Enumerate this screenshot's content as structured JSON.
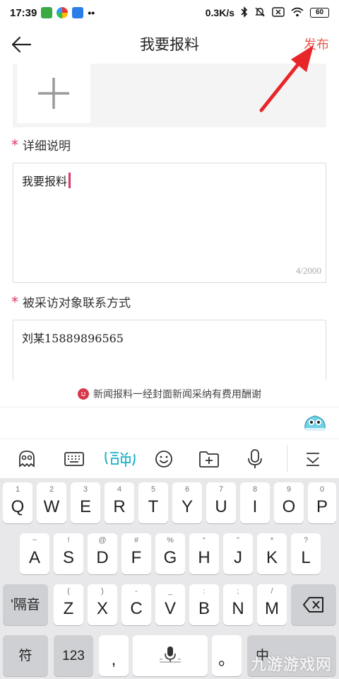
{
  "status_bar": {
    "time": "17:39",
    "net_speed": "0.3K/s",
    "battery": "60"
  },
  "header": {
    "title": "我要报料",
    "publish_label": "发布"
  },
  "details": {
    "required_mark": "*",
    "label": "详细说明",
    "text": "我要报料",
    "counter": "4/2000"
  },
  "contact": {
    "required_mark": "*",
    "label": "被采访对象联系方式",
    "text": "刘某15889896565"
  },
  "notice": {
    "text": "新闻报料一经封面新闻采纳有费用酬谢"
  },
  "keyboard": {
    "row1": [
      {
        "sub": "1",
        "main": "Q"
      },
      {
        "sub": "2",
        "main": "W"
      },
      {
        "sub": "3",
        "main": "E"
      },
      {
        "sub": "4",
        "main": "R"
      },
      {
        "sub": "5",
        "main": "T"
      },
      {
        "sub": "6",
        "main": "Y"
      },
      {
        "sub": "7",
        "main": "U"
      },
      {
        "sub": "8",
        "main": "I"
      },
      {
        "sub": "9",
        "main": "O"
      },
      {
        "sub": "0",
        "main": "P"
      }
    ],
    "row2": [
      {
        "sub": "~",
        "main": "A"
      },
      {
        "sub": "!",
        "main": "S"
      },
      {
        "sub": "@",
        "main": "D"
      },
      {
        "sub": "#",
        "main": "F"
      },
      {
        "sub": "%",
        "main": "G"
      },
      {
        "sub": "“",
        "main": "H"
      },
      {
        "sub": "”",
        "main": "J"
      },
      {
        "sub": "*",
        "main": "K"
      },
      {
        "sub": "?",
        "main": "L"
      }
    ],
    "row3": [
      {
        "sub": "(",
        "main": "Z"
      },
      {
        "sub": ")",
        "main": "X"
      },
      {
        "sub": "-",
        "main": "C"
      },
      {
        "sub": "_",
        "main": "V"
      },
      {
        "sub": ":",
        "main": "B"
      },
      {
        "sub": ";",
        "main": "N"
      },
      {
        "sub": "/",
        "main": "M"
      }
    ],
    "separator_label": "'隔音",
    "symbol_label": "符",
    "number_label": "123",
    "comma_label": ",",
    "period_label": "。",
    "lang_label": "中"
  },
  "watermark": "九游游戏网",
  "colors": {
    "accent_pink": "#d83a64",
    "publish_orange": "#e85a4f",
    "annotation_red": "#e8262a"
  }
}
